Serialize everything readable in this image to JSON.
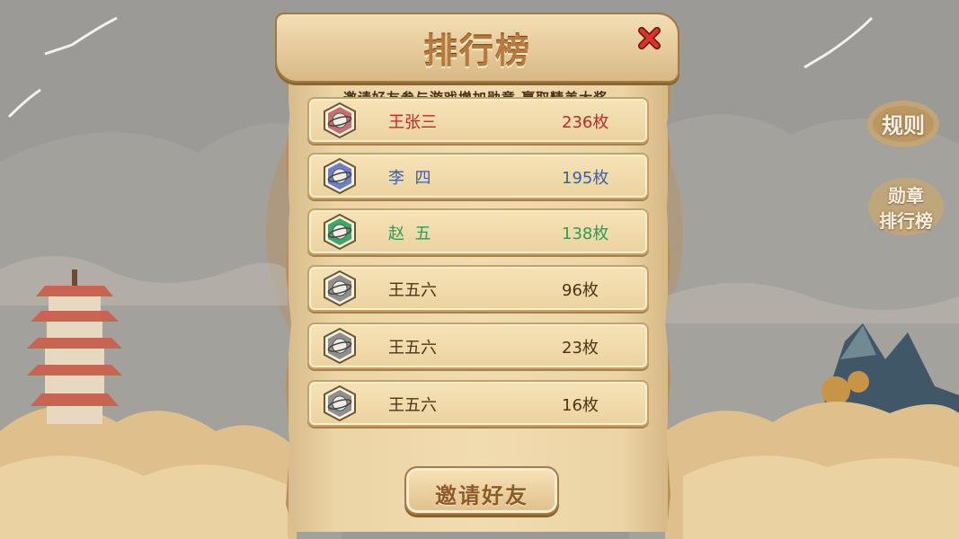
{
  "panel": {
    "title": "排行榜",
    "subtitle": "邀请好友参与游戏增加勋章  赢取精美大奖",
    "close_icon": "close-x-icon"
  },
  "leaderboard": [
    {
      "name": "王张三",
      "count": "236枚",
      "color": "#c0272d",
      "badge_color": "#c96d6d",
      "badge_icon": "planet-medal-icon"
    },
    {
      "name": "李  四",
      "count": "195枚",
      "color": "#3d5fa8",
      "badge_color": "#6c7fcf",
      "badge_icon": "planet-medal-icon"
    },
    {
      "name": "赵  五",
      "count": "138枚",
      "color": "#2e9a5b",
      "badge_color": "#3aa868",
      "badge_icon": "planet-medal-icon"
    },
    {
      "name": "王五六",
      "count": "96枚",
      "color": "#4a3516",
      "badge_color": "#8e8e8e",
      "badge_icon": "planet-medal-icon"
    },
    {
      "name": "王五六",
      "count": "23枚",
      "color": "#4a3516",
      "badge_color": "#8e8e8e",
      "badge_icon": "planet-medal-icon"
    },
    {
      "name": "王五六",
      "count": "16枚",
      "color": "#4a3516",
      "badge_color": "#8e8e8e",
      "badge_icon": "planet-medal-icon"
    }
  ],
  "invite_button": {
    "label": "邀请好友"
  },
  "side_menu": {
    "rules_label": "规则",
    "medal_rank_line1": "勋章",
    "medal_rank_line2": "排行榜"
  },
  "colors": {
    "parchment": "#f1dcb1",
    "title_brown": "#b9793a",
    "close_red": "#d8262a"
  }
}
